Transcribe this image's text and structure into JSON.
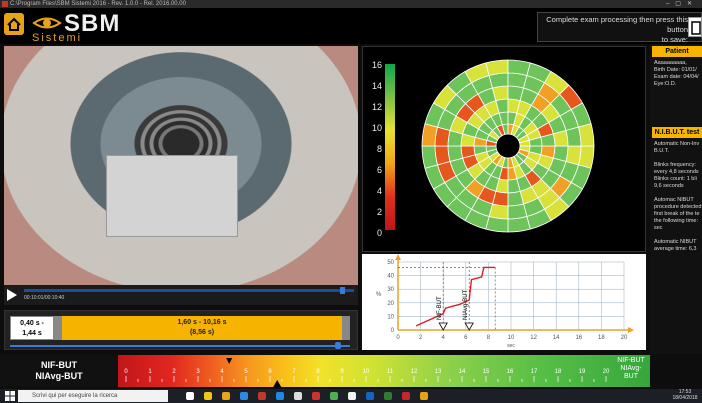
{
  "window": {
    "title": "C:\\Program Files\\SBM Sistemi 2016 - Rev. 1.0.0 - Rel. 2016.00.00"
  },
  "header": {
    "logo_text": "SBM",
    "logo_sub": "Sistemi",
    "save_prompt_line1": "Complete exam processing then press this button",
    "save_prompt_line2": "to save:"
  },
  "video": {
    "time_text": "00:10:01/00:10:40"
  },
  "range": {
    "left_line1": "0,40 s -",
    "left_line2": "1,44 s",
    "main_line1": "1,60 s - 10,16 s",
    "main_line2": "(8,56 s)"
  },
  "map": {
    "scale_labels": [
      "16",
      "14",
      "12",
      "10",
      "8",
      "6",
      "4",
      "2",
      "0"
    ]
  },
  "chart": {
    "y_ticks": [
      "50",
      "40",
      "30",
      "20",
      "10",
      "0"
    ],
    "x_ticks": [
      "0",
      "2",
      "4",
      "6",
      "8",
      "10",
      "12",
      "14",
      "16",
      "18",
      "20"
    ],
    "marker1_label": "NIF-BUT",
    "marker2_label": "NIAvg-BUT",
    "y_unit": "%",
    "x_unit": "sec"
  },
  "info": {
    "patient_head": "Patient",
    "patient_lines": [
      "Aaaaaaaaaa,",
      "Birth Date: 01/01/",
      "Exam date: 04/04/",
      "Eye:O.D."
    ],
    "nibut_head": "N.I.B.U.T. test",
    "nibut_lines": [
      "Automatic Non-Inv",
      "B.U.T.",
      "",
      "Blinks frequency:",
      "every 4,8 seconds",
      "Blinks count: 1 bli",
      "9,6 seconds",
      "",
      "Automac NIBUT",
      "procedure detected",
      "first break of the te",
      "the following time:",
      "sec",
      "",
      "Automatic NIBUT",
      "average time: 6,3"
    ]
  },
  "bottom": {
    "nif_left_line1": "NIF-BUT",
    "nif_left_line2": "NIAvg-BUT",
    "scale_numbers": [
      "0",
      "1",
      "2",
      "3",
      "4",
      "5",
      "6",
      "7",
      "8",
      "9",
      "10",
      "11",
      "12",
      "13",
      "14",
      "15",
      "16",
      "17",
      "18",
      "19",
      "20"
    ],
    "nif_right_line1": "NIF-BUT",
    "nif_right_line2": "NIAvg-",
    "nif_right_line3": "BUT"
  },
  "taskbar": {
    "search_placeholder": "Scrivi qui per eseguire la ricerca",
    "time": "17:53",
    "date": "18/04/2018"
  }
}
